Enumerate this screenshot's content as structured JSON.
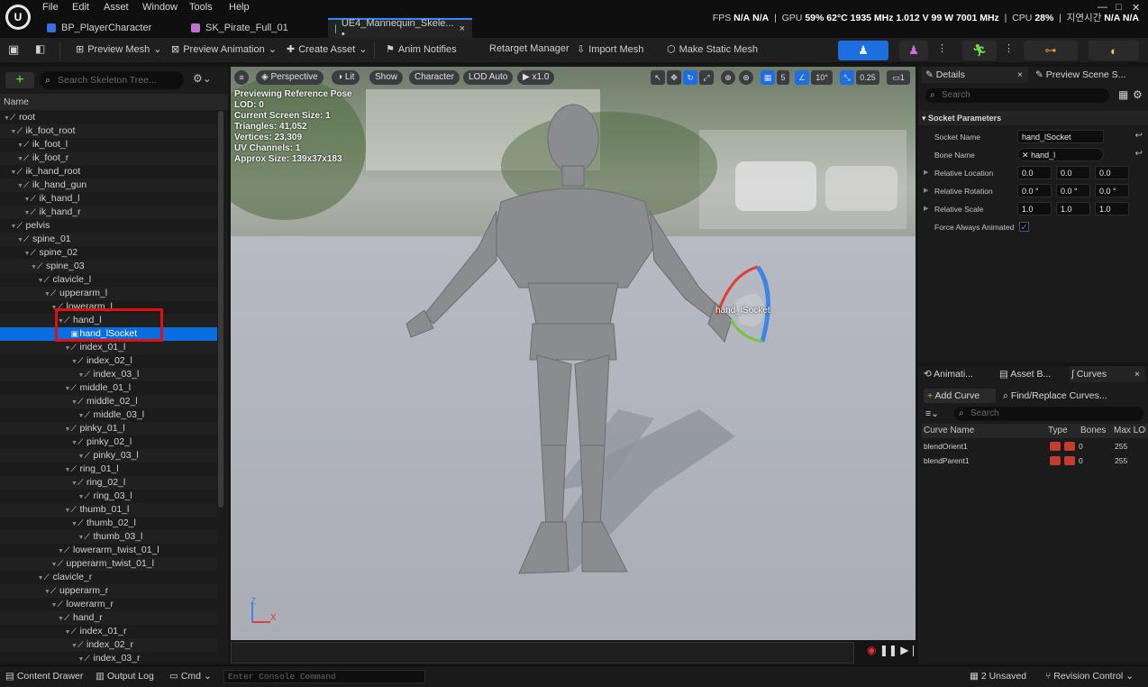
{
  "app": {
    "logo": "U"
  },
  "menu": [
    "File",
    "Edit",
    "Asset",
    "Window",
    "Tools",
    "Help"
  ],
  "tabs": [
    {
      "label": "BP_PlayerCharacter",
      "color": "#3a6ee0"
    },
    {
      "label": "SK_Pirate_Full_01",
      "color": "#c070d0"
    },
    {
      "label": "UE4_Mannequin_Skele... •",
      "color": "#48c0c0"
    }
  ],
  "stats": {
    "fps_label": "FPS",
    "fps": "N/A",
    "fps2": "N/A",
    "gpu_label": "GPU",
    "gpu": "59% 62°C 1935 MHz 1.012 V 99 W 7001 MHz",
    "cpu_label": "CPU",
    "cpu": "28%",
    "latency_label": "지연시간",
    "latency": "N/A N/A"
  },
  "toolbar": {
    "preview_mesh": "Preview Mesh",
    "preview_animation": "Preview Animation",
    "create_asset": "Create Asset",
    "anim_notifies": "Anim Notifies",
    "retarget_manager": "Retarget Manager",
    "import_mesh": "Import Mesh",
    "make_static_mesh": "Make Static Mesh"
  },
  "tree": {
    "search_placeholder": "Search Skeleton Tree...",
    "column_name": "Name",
    "rows": [
      {
        "label": "root",
        "indent": 0
      },
      {
        "label": "ik_foot_root",
        "indent": 1
      },
      {
        "label": "ik_foot_l",
        "indent": 2
      },
      {
        "label": "ik_foot_r",
        "indent": 2
      },
      {
        "label": "ik_hand_root",
        "indent": 1
      },
      {
        "label": "ik_hand_gun",
        "indent": 2
      },
      {
        "label": "ik_hand_l",
        "indent": 3
      },
      {
        "label": "ik_hand_r",
        "indent": 3
      },
      {
        "label": "pelvis",
        "indent": 1
      },
      {
        "label": "spine_01",
        "indent": 2
      },
      {
        "label": "spine_02",
        "indent": 3
      },
      {
        "label": "spine_03",
        "indent": 4
      },
      {
        "label": "clavicle_l",
        "indent": 5
      },
      {
        "label": "upperarm_l",
        "indent": 6
      },
      {
        "label": "lowerarm_l",
        "indent": 7
      },
      {
        "label": "hand_l",
        "indent": 8
      },
      {
        "label": "hand_lSocket",
        "indent": 9,
        "socket": true
      },
      {
        "label": "index_01_l",
        "indent": 9
      },
      {
        "label": "index_02_l",
        "indent": 10
      },
      {
        "label": "index_03_l",
        "indent": 11
      },
      {
        "label": "middle_01_l",
        "indent": 9
      },
      {
        "label": "middle_02_l",
        "indent": 10
      },
      {
        "label": "middle_03_l",
        "indent": 11
      },
      {
        "label": "pinky_01_l",
        "indent": 9
      },
      {
        "label": "pinky_02_l",
        "indent": 10
      },
      {
        "label": "pinky_03_l",
        "indent": 11
      },
      {
        "label": "ring_01_l",
        "indent": 9
      },
      {
        "label": "ring_02_l",
        "indent": 10
      },
      {
        "label": "ring_03_l",
        "indent": 11
      },
      {
        "label": "thumb_01_l",
        "indent": 9
      },
      {
        "label": "thumb_02_l",
        "indent": 10
      },
      {
        "label": "thumb_03_l",
        "indent": 11
      },
      {
        "label": "lowerarm_twist_01_l",
        "indent": 8
      },
      {
        "label": "upperarm_twist_01_l",
        "indent": 7
      },
      {
        "label": "clavicle_r",
        "indent": 5
      },
      {
        "label": "upperarm_r",
        "indent": 6
      },
      {
        "label": "lowerarm_r",
        "indent": 7
      },
      {
        "label": "hand_r",
        "indent": 8
      },
      {
        "label": "index_01_r",
        "indent": 9
      },
      {
        "label": "index_02_r",
        "indent": 10
      },
      {
        "label": "index_03_r",
        "indent": 11
      }
    ],
    "selected_index": 16
  },
  "viewport": {
    "perspective": "Perspective",
    "lit": "Lit",
    "show": "Show",
    "character": "Character",
    "lod": "LOD Auto",
    "speed": "x1.0",
    "grid_size": "5",
    "angle": "10°",
    "scale": "0.25",
    "camera_speed": "1",
    "info": [
      "Previewing Reference Pose",
      "LOD: 0",
      "Current Screen Size: 1",
      "Triangles: 41,052",
      "Vertices: 23,309",
      "UV Channels: 1",
      "Approx Size: 139x37x183"
    ],
    "socket_label": "hand_lSocket",
    "axis_z": "Z",
    "axis_x": "X"
  },
  "details": {
    "tab_details": "Details",
    "tab_preview": "Preview Scene S...",
    "search_placeholder": "Search",
    "section": "Socket Parameters",
    "socket_name_label": "Socket Name",
    "socket_name": "hand_lSocket",
    "bone_name_label": "Bone Name",
    "bone_name": "hand_l",
    "rel_loc_label": "Relative Location",
    "rel_loc": [
      "0.0",
      "0.0",
      "0.0"
    ],
    "rel_rot_label": "Relative Rotation",
    "rel_rot": [
      "0.0 °",
      "0.0 °",
      "0.0 °"
    ],
    "rel_scale_label": "Relative Scale",
    "rel_scale": [
      "1.0",
      "1.0",
      "1.0"
    ],
    "force_label": "Force Always Animated",
    "force_checked": true
  },
  "curves": {
    "tab_anim": "Animati...",
    "tab_asset": "Asset B...",
    "tab_curves": "Curves",
    "add_curve": "Add Curve",
    "find_replace": "Find/Replace Curves...",
    "search_placeholder": "Search",
    "col_name": "Curve Name",
    "col_type": "Type",
    "col_bones": "Bones",
    "col_max": "Max LOD",
    "rows": [
      {
        "name": "blendOrient1",
        "bones": "0",
        "max": "255"
      },
      {
        "name": "blendParent1",
        "bones": "0",
        "max": "255"
      }
    ]
  },
  "statusbar": {
    "content_drawer": "Content Drawer",
    "output_log": "Output Log",
    "cmd": "Cmd",
    "console_placeholder": "Enter Console Command",
    "unsaved": "2 Unsaved",
    "revision": "Revision Control"
  },
  "colors": {
    "accent": "#0a6ee0",
    "highlight": "#e01010"
  }
}
